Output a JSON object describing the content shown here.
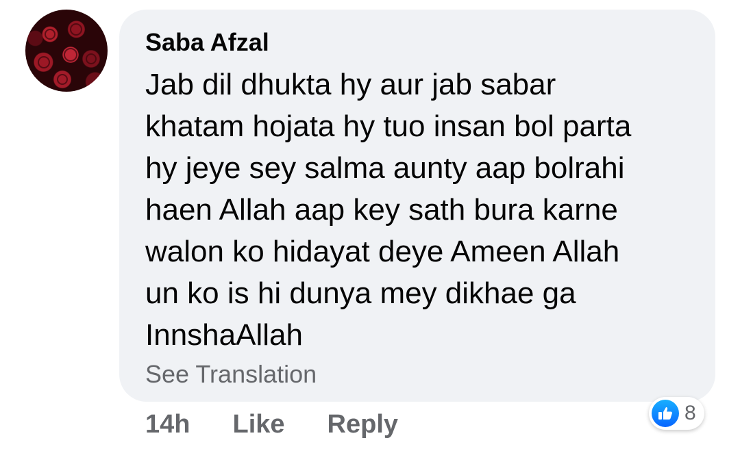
{
  "comment": {
    "author": "Saba Afzal",
    "text_lines": [
      "Jab dil dhukta hy aur jab sabar",
      "khatam hojata hy tuo insan bol parta",
      "hy jeye sey salma aunty aap bolrahi",
      "haen Allah aap key sath bura karne",
      "walon ko hidayat deye Ameen Allah",
      "un ko is hi dunya mey dikhae ga",
      "InnshaAllah"
    ],
    "see_translation": "See Translation",
    "avatar_icon": "rose-avatar"
  },
  "actions": {
    "time": "14h",
    "like": "Like",
    "reply": "Reply"
  },
  "reactions": {
    "icon": "like-thumb-icon",
    "count": "8",
    "badge_color": "#1877f2"
  },
  "colors": {
    "bubble_bg": "#f0f2f5",
    "text": "#050505",
    "secondary": "#65676b"
  }
}
